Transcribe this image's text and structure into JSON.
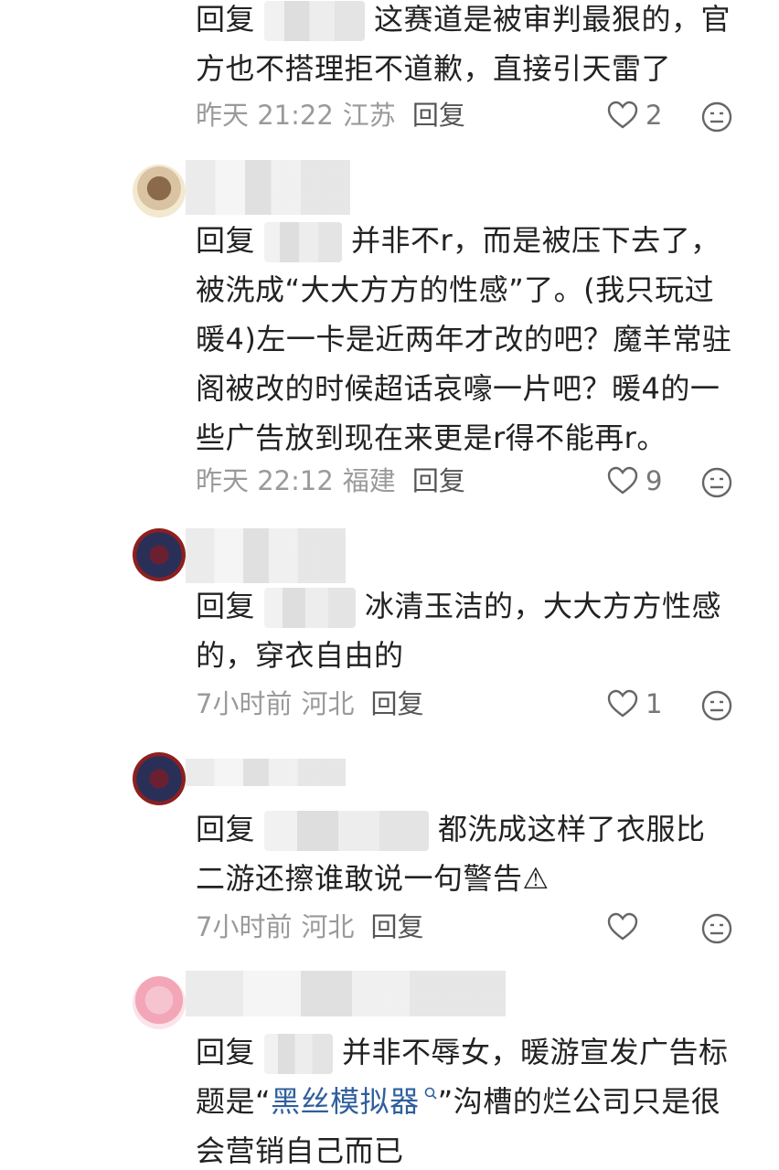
{
  "comments": [
    {
      "reply_label": "回复",
      "text_line1": "这赛道是被审判最狠的，官",
      "text_line2": "方也不搭理拒不道歉，直接引天雷了",
      "time": "昨天 21:22",
      "location": "江苏",
      "reply_action": "回复",
      "likes": "2"
    },
    {
      "reply_label": "回复",
      "text": "并非不r，而是被压下去了，被洗成“大大方方的性感”了。(我只玩过暖4)左一卡是近两年才改的吧？魔羊常驻阁被改的时候超话哀嚎一片吧？暖4的一些广告放到现在来更是r得不能再r。",
      "time": "昨天 22:12",
      "location": "福建",
      "reply_action": "回复",
      "likes": "9"
    },
    {
      "reply_label": "回复",
      "text": "冰清玉洁的，大大方方性感的，穿衣自由的",
      "time": "7小时前",
      "location": "河北",
      "reply_action": "回复",
      "likes": "1"
    },
    {
      "reply_label": "回复",
      "text": "都洗成这样了衣服比二游还擦谁敢说一句警告⚠",
      "time": "7小时前",
      "location": "河北",
      "reply_action": "回复",
      "likes": ""
    },
    {
      "reply_label": "回复",
      "text_before": "并非不辱女，暖游宣发广告标题是“",
      "link_text": "黑丝模拟器",
      "text_after": "”沟槽的烂公司只是很会营销自己而已"
    }
  ],
  "colors": {
    "text": "#222222",
    "meta": "#9a9a9a",
    "link": "#2f5f9e"
  },
  "icons": [
    "heart-icon",
    "dislike-face-icon",
    "search-icon"
  ]
}
